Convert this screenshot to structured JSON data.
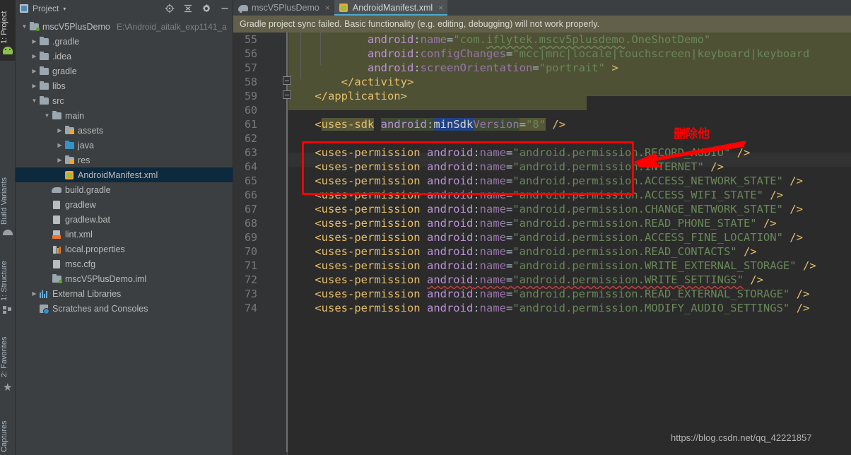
{
  "toolstrip": {
    "items": [
      {
        "label": "1: Project",
        "icon": "project-icon",
        "active": true
      },
      {
        "label": "Build Variants",
        "icon": "build-variants-icon",
        "active": false
      },
      {
        "label": "1: Structure",
        "icon": "structure-icon",
        "active": false
      },
      {
        "label": "2: Favorites",
        "icon": "favorites-star-icon",
        "active": false
      },
      {
        "label": "Captures",
        "icon": "captures-icon",
        "active": false
      }
    ],
    "android_icon": "android-head-icon"
  },
  "project_panel": {
    "title": "Project",
    "caret": "▾",
    "tools": [
      "locate-target-icon",
      "collapse-all-icon",
      "settings-gear-icon",
      "minimize-icon"
    ],
    "tree": [
      {
        "label": "mscV5PlusDemo",
        "path": "E:\\Android_aitalk_exp1141_a",
        "indent": 0,
        "arrow": "▼",
        "icon": "module-folder-icon"
      },
      {
        "label": ".gradle",
        "path": "",
        "indent": 1,
        "arrow": "▶",
        "icon": "folder-icon"
      },
      {
        "label": ".idea",
        "path": "",
        "indent": 1,
        "arrow": "▶",
        "icon": "folder-icon"
      },
      {
        "label": "gradle",
        "path": "",
        "indent": 1,
        "arrow": "▶",
        "icon": "folder-icon"
      },
      {
        "label": "libs",
        "path": "",
        "indent": 1,
        "arrow": "▶",
        "icon": "folder-icon"
      },
      {
        "label": "src",
        "path": "",
        "indent": 1,
        "arrow": "▼",
        "icon": "folder-icon"
      },
      {
        "label": "main",
        "path": "",
        "indent": 2,
        "arrow": "▼",
        "icon": "folder-icon"
      },
      {
        "label": "assets",
        "path": "",
        "indent": 3,
        "arrow": "▶",
        "icon": "assets-folder-icon"
      },
      {
        "label": "java",
        "path": "",
        "indent": 3,
        "arrow": "▶",
        "icon": "java-source-folder-icon"
      },
      {
        "label": "res",
        "path": "",
        "indent": 3,
        "arrow": "▶",
        "icon": "res-folder-icon"
      },
      {
        "label": "AndroidManifest.xml",
        "path": "",
        "indent": 3,
        "arrow": "",
        "icon": "android-manifest-icon",
        "selected": true
      },
      {
        "label": "build.gradle",
        "path": "",
        "indent": 2,
        "arrow": "",
        "icon": "gradle-file-icon"
      },
      {
        "label": "gradlew",
        "path": "",
        "indent": 2,
        "arrow": "",
        "icon": "file-icon"
      },
      {
        "label": "gradlew.bat",
        "path": "",
        "indent": 2,
        "arrow": "",
        "icon": "file-icon"
      },
      {
        "label": "lint.xml",
        "path": "",
        "indent": 2,
        "arrow": "",
        "icon": "lint-xml-icon"
      },
      {
        "label": "local.properties",
        "path": "",
        "indent": 2,
        "arrow": "",
        "icon": "properties-file-icon"
      },
      {
        "label": "msc.cfg",
        "path": "",
        "indent": 2,
        "arrow": "",
        "icon": "file-icon"
      },
      {
        "label": "mscV5PlusDemo.iml",
        "path": "",
        "indent": 2,
        "arrow": "",
        "icon": "iml-file-icon"
      },
      {
        "label": "External Libraries",
        "path": "",
        "indent": 1,
        "arrow": "▶",
        "icon": "external-libraries-icon"
      },
      {
        "label": "Scratches and Consoles",
        "path": "",
        "indent": 1,
        "arrow": "",
        "icon": "scratches-icon"
      }
    ]
  },
  "editor": {
    "tabs": [
      {
        "label": "mscV5PlusDemo",
        "icon": "gradle-elephant-icon",
        "active": false,
        "close": "×"
      },
      {
        "label": "AndroidManifest.xml",
        "icon": "android-manifest-icon",
        "active": true,
        "close": "×"
      }
    ],
    "notification": "Gradle project sync failed. Basic functionality (e.g. editing, debugging) will not work properly.",
    "line_start": 55,
    "lines": [
      {
        "n": 55,
        "text": "            android:name=\"com.iflytek.mscv5plusdemo.OneShotDemo\""
      },
      {
        "n": 56,
        "text": "            android:configChanges=\"mcc|mnc|locale|touchscreen|keyboard|keyboard"
      },
      {
        "n": 57,
        "text": "            android:screenOrientation=\"portrait\" >"
      },
      {
        "n": 58,
        "text": "        </activity>"
      },
      {
        "n": 59,
        "text": "    </application>"
      },
      {
        "n": 60,
        "text": ""
      },
      {
        "n": 61,
        "text": "    <uses-sdk android:minSdkVersion=\"8\" />"
      },
      {
        "n": 62,
        "text": ""
      },
      {
        "n": 63,
        "text": "    <uses-permission android:name=\"android.permission.RECORD_AUDIO\" />"
      },
      {
        "n": 64,
        "text": "    <uses-permission android:name=\"android.permission.INTERNET\" />"
      },
      {
        "n": 65,
        "text": "    <uses-permission android:name=\"android.permission.ACCESS_NETWORK_STATE\" />"
      },
      {
        "n": 66,
        "text": "    <uses-permission android:name=\"android.permission.ACCESS_WIFI_STATE\" />"
      },
      {
        "n": 67,
        "text": "    <uses-permission android:name=\"android.permission.CHANGE_NETWORK_STATE\" />"
      },
      {
        "n": 68,
        "text": "    <uses-permission android:name=\"android.permission.READ_PHONE_STATE\" />"
      },
      {
        "n": 69,
        "text": "    <uses-permission android:name=\"android.permission.ACCESS_FINE_LOCATION\" />"
      },
      {
        "n": 70,
        "text": "    <uses-permission android:name=\"android.permission.READ_CONTACTS\" />"
      },
      {
        "n": 71,
        "text": "    <uses-permission android:name=\"android.permission.WRITE_EXTERNAL_STORAGE\" />"
      },
      {
        "n": 72,
        "text": "    <uses-permission android:name=\"android.permission.WRITE_SETTINGS\" />"
      },
      {
        "n": 73,
        "text": "    <uses-permission android:name=\"android.permission.READ_EXTERNAL_STORAGE\" />"
      },
      {
        "n": 74,
        "text": "    <uses-permission android:name=\"android.permission.MODIFY_AUDIO_SETTINGS\" />"
      }
    ],
    "selection_text": "minSdk",
    "selected_attr_value": "8"
  },
  "annotation": {
    "note_text": "删除他",
    "note_color": "#fe0000",
    "box_color": "#fe0000"
  },
  "watermark": {
    "text": "https://blog.csdn.net/qq_42221857"
  },
  "colors": {
    "panel_bg": "#3c3f41",
    "editor_bg": "#2b2b2b",
    "gutter_bg": "#313335",
    "notification_bg": "#62604a",
    "tab_active_bg": "#4e5254",
    "tab_underline": "#4aaad6",
    "selection_bg": "#214283",
    "highlight_bg": "#4f5135",
    "tree_selected_bg": "#0d293e"
  }
}
